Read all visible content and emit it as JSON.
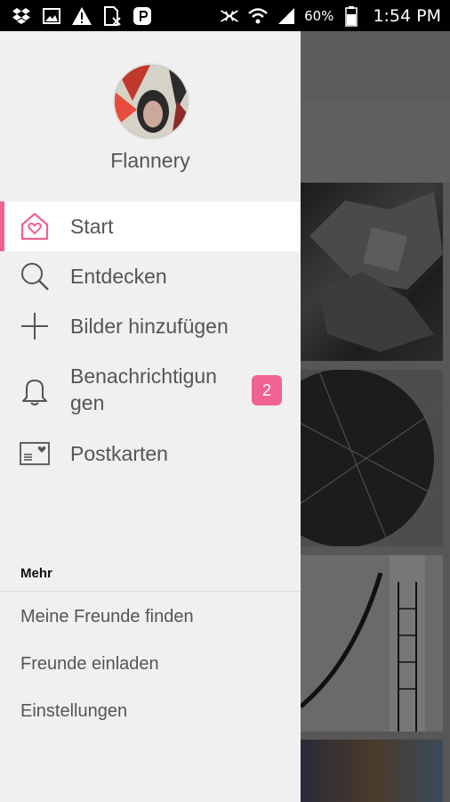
{
  "status_bar": {
    "battery_percent": "60%",
    "time": "1:54 PM"
  },
  "drawer": {
    "user": {
      "name": "Flannery"
    },
    "nav": [
      {
        "label": "Start",
        "icon": "home-heart-icon",
        "active": true
      },
      {
        "label": "Entdecken",
        "icon": "search-icon"
      },
      {
        "label": "Bilder hinzufügen",
        "icon": "plus-icon"
      },
      {
        "label_line1": "Benachrichtigun",
        "label_line2": "gen",
        "icon": "bell-icon",
        "badge": "2"
      },
      {
        "label": "Postkarten",
        "icon": "postcard-icon"
      }
    ],
    "more": {
      "title": "Mehr",
      "items": [
        "Meine Freunde finden",
        "Freunde einladen",
        "Einstellungen"
      ]
    }
  },
  "colors": {
    "accent": "#f06292",
    "drawer_bg": "#f0f0f0",
    "text": "#555555"
  }
}
